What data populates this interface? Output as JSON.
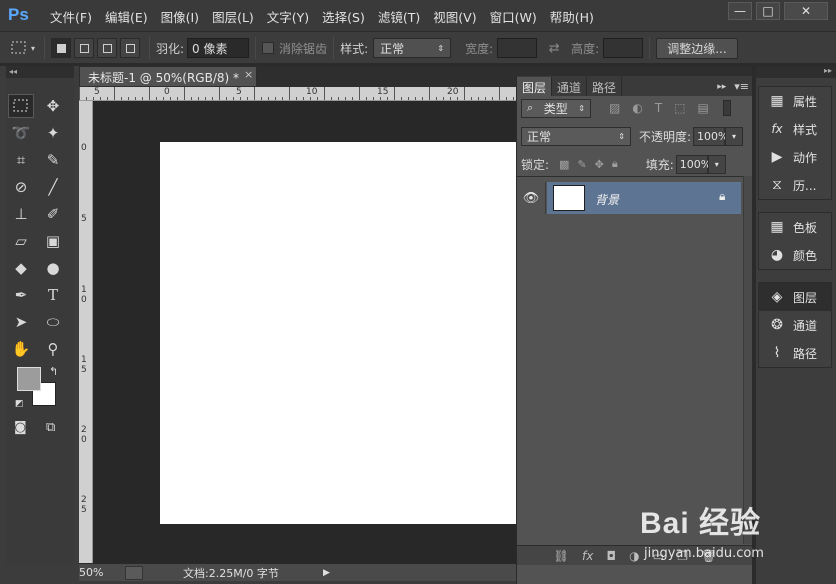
{
  "app": {
    "logo": "Ps",
    "menu": [
      "文件(F)",
      "编辑(E)",
      "图像(I)",
      "图层(L)",
      "文字(Y)",
      "选择(S)",
      "滤镜(T)",
      "视图(V)",
      "窗口(W)",
      "帮助(H)"
    ],
    "window_controls": {
      "minimize": "—",
      "maximize": "□",
      "close": "✕"
    }
  },
  "options_bar": {
    "feather_label": "羽化:",
    "feather_value": "0 像素",
    "antialias_label": "消除锯齿",
    "style_label": "样式:",
    "style_value": "正常",
    "width_label": "宽度:",
    "height_label": "高度:",
    "refine_edge_button": "调整边缘..."
  },
  "document": {
    "tab_title": "未标题-1 @ 50%(RGB/8) *",
    "tab_close": "×",
    "ruler_top_labels": [
      "5",
      "0",
      "5",
      "10",
      "15",
      "20"
    ],
    "ruler_left_labels": [
      "0",
      "5",
      "1",
      "0",
      "1",
      "5",
      "2",
      "0",
      "2",
      "5"
    ],
    "zoom": "50%",
    "doc_info": "文档:2.25M/0 字节"
  },
  "layers_panel": {
    "tabs": [
      "图层",
      "通道",
      "路径"
    ],
    "active_tab": "图层",
    "filter_kind": "类型",
    "blend_mode": "正常",
    "opacity_label": "不透明度:",
    "opacity_value": "100%",
    "lock_label": "锁定:",
    "fill_label": "填充:",
    "fill_value": "100%",
    "layers": [
      {
        "name": "背景",
        "visible": true,
        "locked": true
      }
    ]
  },
  "right_dock": {
    "group1": [
      "属性",
      "样式",
      "动作",
      "历..."
    ],
    "group2": [
      "色板",
      "颜色"
    ],
    "group3": [
      "图层",
      "通道",
      "路径"
    ],
    "active": "图层"
  },
  "watermark": {
    "brand": "Bai 经验",
    "url": "jingyan.baidu.com"
  }
}
